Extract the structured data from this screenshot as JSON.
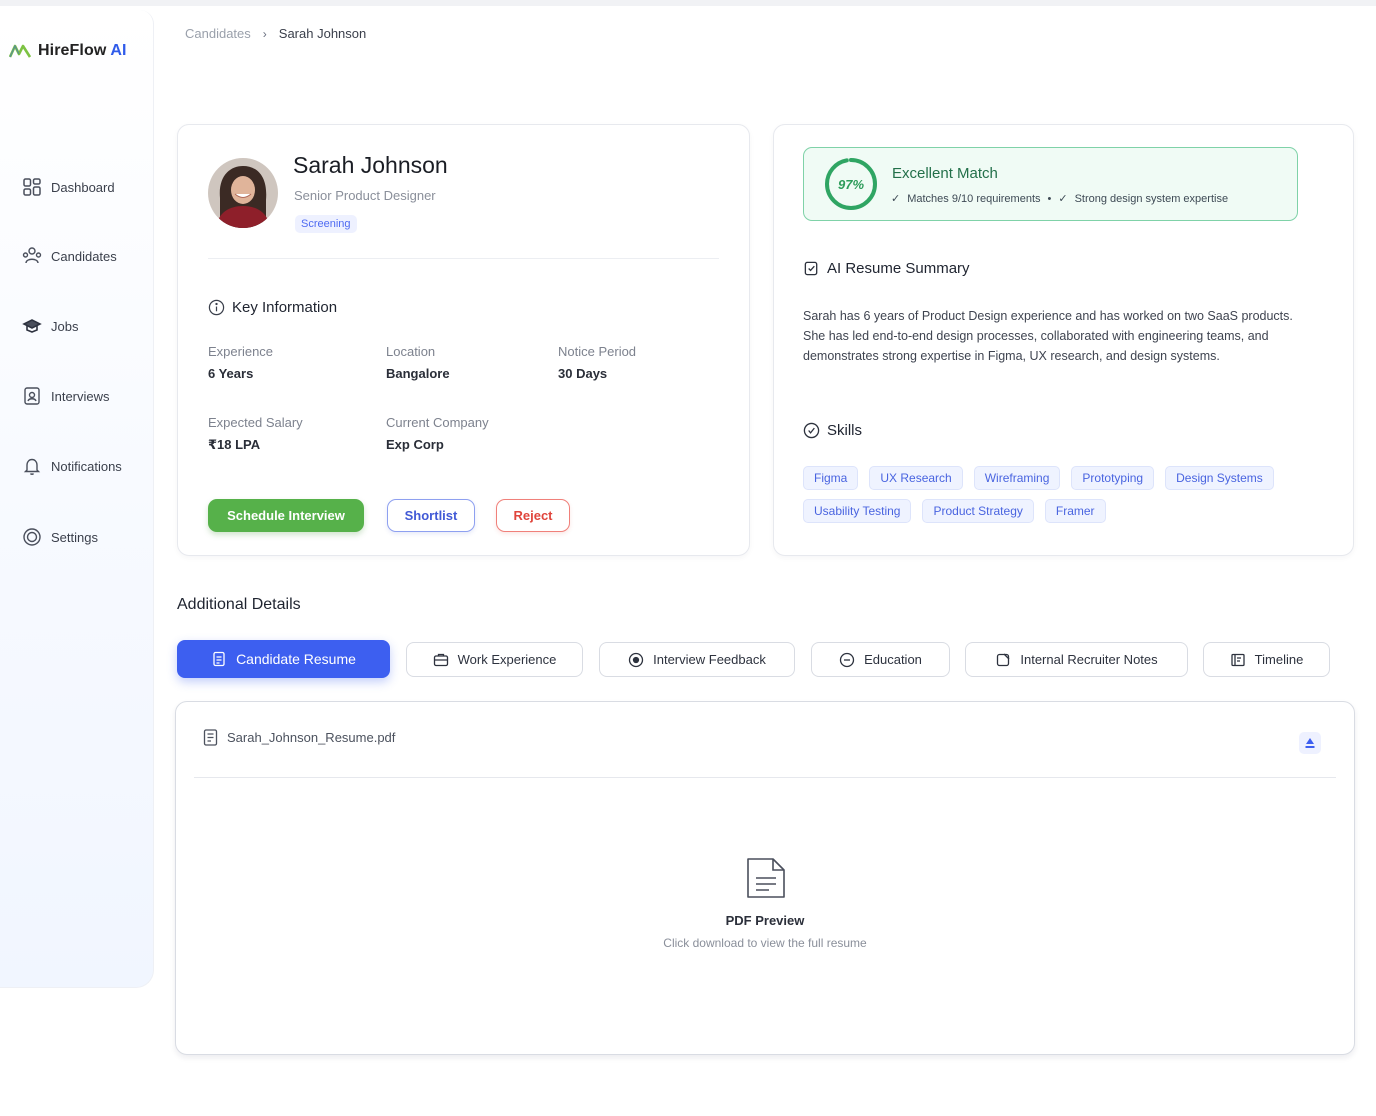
{
  "app": {
    "brand_name": "HireFlow",
    "brand_ai": "AI",
    "accent": "#3d5ff0"
  },
  "sidebar": {
    "items": [
      {
        "label": "Dashboard",
        "icon": "dashboard-icon"
      },
      {
        "label": "Candidates",
        "icon": "candidates-icon"
      },
      {
        "label": "Jobs",
        "icon": "jobs-icon"
      },
      {
        "label": "Interviews",
        "icon": "interviews-icon"
      },
      {
        "label": "Notifications",
        "icon": "bell-icon"
      },
      {
        "label": "Settings",
        "icon": "settings-icon"
      }
    ]
  },
  "breadcrumb": {
    "parent": "Candidates",
    "separator": "›",
    "current": "Sarah Johnson"
  },
  "profile": {
    "name": "Sarah Johnson",
    "role": "Senior Product Designer",
    "status": "Screening",
    "key_info_title": "Key Information",
    "fields": [
      {
        "label": "Experience",
        "value": "6 Years"
      },
      {
        "label": "Location",
        "value": "Bangalore"
      },
      {
        "label": "Notice Period",
        "value": "30 Days"
      },
      {
        "label": "Expected Salary",
        "value": "₹18 LPA"
      },
      {
        "label": "Current Company",
        "value": "Exp Corp"
      }
    ],
    "actions": {
      "schedule": "Schedule Interview",
      "shortlist": "Shortlist",
      "reject": "Reject"
    }
  },
  "ai": {
    "match_percent": 97,
    "match_label": "97%",
    "match_title": "Excellent Match",
    "match_points": [
      "Matches 9/10 requirements",
      "Strong design system expertise"
    ],
    "summary_title": "AI Resume Summary",
    "summary": "Sarah has 6 years of Product Design experience and has worked on two SaaS products. She has led end-to-end design processes, collaborated with engineering teams, and demonstrates strong expertise in Figma, UX research, and design systems.",
    "skills_title": "Skills",
    "skills": [
      "Figma",
      "UX Research",
      "Wireframing",
      "Prototyping",
      "Design Systems",
      "Usability Testing",
      "Product Strategy",
      "Framer"
    ]
  },
  "details": {
    "title": "Additional Details",
    "tabs": [
      {
        "label": "Candidate Resume",
        "icon": "resume-icon",
        "active": true
      },
      {
        "label": "Work Experience",
        "icon": "briefcase-icon",
        "active": false
      },
      {
        "label": "Interview Feedback",
        "icon": "feedback-icon",
        "active": false
      },
      {
        "label": "Education",
        "icon": "education-icon",
        "active": false
      },
      {
        "label": "Internal Recruiter Notes",
        "icon": "notes-icon",
        "active": false
      },
      {
        "label": "Timeline",
        "icon": "timeline-icon",
        "active": false
      }
    ],
    "file_name": "Sarah_Johnson_Resume.pdf",
    "preview_title": "PDF Preview",
    "preview_sub": "Click download to view the full resume"
  }
}
